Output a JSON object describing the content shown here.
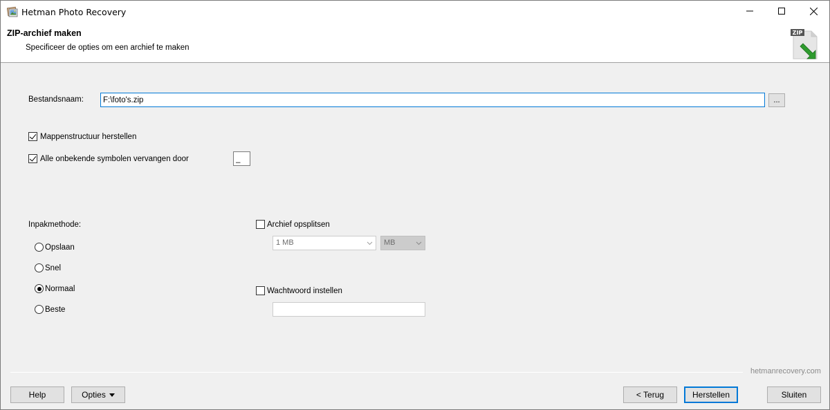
{
  "window": {
    "title": "Hetman Photo Recovery"
  },
  "header": {
    "title": "ZIP-archief maken",
    "subtitle": "Specificeer de opties om een archief te maken",
    "icon_badge": "ZIP"
  },
  "form": {
    "filename_label": "Bestandsnaam:",
    "filename_value": "F:\\foto's.zip",
    "browse_label": "...",
    "restore_folders": {
      "label": "Mappenstructuur herstellen",
      "checked": true
    },
    "replace_symbols": {
      "label": "Alle onbekende symbolen vervangen door",
      "checked": true,
      "value": "_"
    },
    "pack_method": {
      "label": "Inpakmethode:",
      "options": [
        "Opslaan",
        "Snel",
        "Normaal",
        "Beste"
      ],
      "selected": "Normaal"
    },
    "split_archive": {
      "label": "Archief opsplitsen",
      "checked": false,
      "size_value": "1 MB",
      "unit_value": "MB"
    },
    "set_password": {
      "label": "Wachtwoord instellen",
      "checked": false,
      "value": ""
    }
  },
  "footer": {
    "brand": "hetmanrecovery.com",
    "help": "Help",
    "options": "Opties",
    "back": "< Terug",
    "restore": "Herstellen",
    "close": "Sluiten"
  },
  "colors": {
    "accent": "#0078d7",
    "background": "#f0f0f0",
    "header_background": "#ffffff"
  }
}
